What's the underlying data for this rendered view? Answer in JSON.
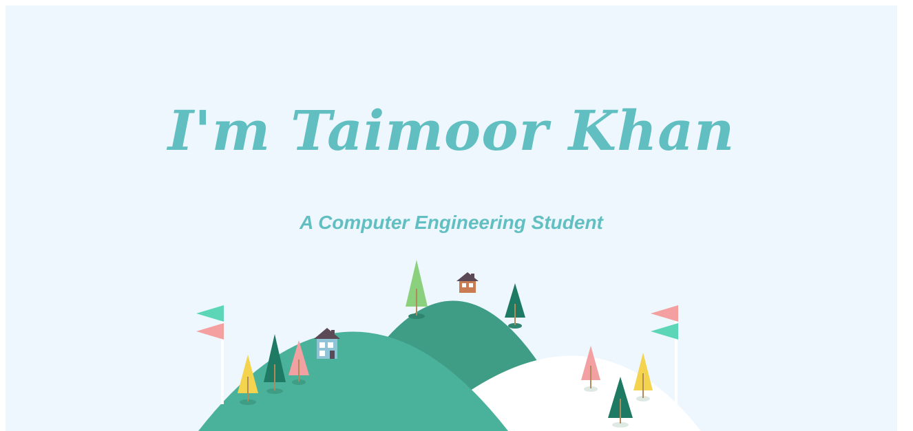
{
  "hero": {
    "title": "I'm Taimoor Khan",
    "subtitle": "A Computer Engineering Student"
  },
  "colors": {
    "background": "#eef7fe",
    "accent": "#62bfc1",
    "hill_back": "#3f9c85",
    "hill_front": "#4ab29b",
    "snow_hill": "#ffffff",
    "tree_dark": "#1e7a62",
    "tree_light_green": "#8bd07c",
    "tree_pink": "#f3a0a2",
    "tree_yellow": "#f4d34f",
    "flag_mint": "#5dd6b8",
    "flag_pink": "#f4a0a0",
    "house_roof": "#5b4a55",
    "house_blue": "#8ec4d6",
    "house_orange": "#c97b52"
  },
  "illustration": {
    "icons": [
      "flag-icon",
      "tree-icon",
      "house-icon",
      "hill-icon"
    ]
  }
}
